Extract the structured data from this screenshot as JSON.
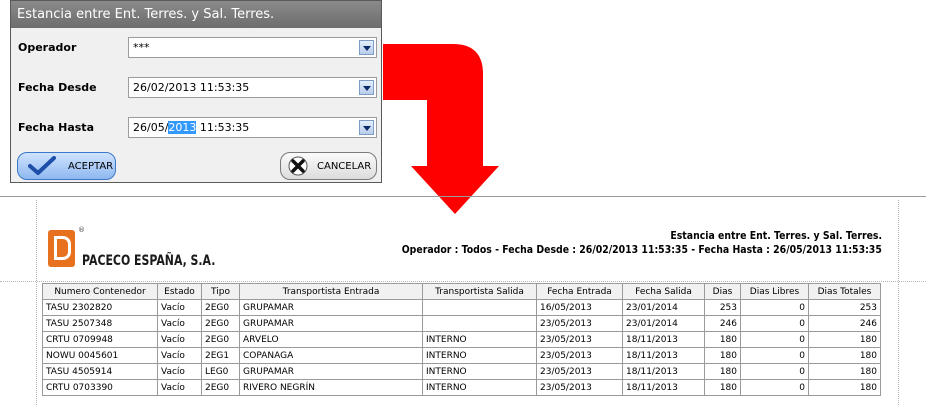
{
  "dialog": {
    "title": "Estancia entre Ent. Terres. y Sal. Terres.",
    "fields": [
      {
        "label": "Operador",
        "value": "***"
      },
      {
        "label": "Fecha Desde",
        "value": "26/02/2013 11:53:35"
      },
      {
        "label": "Fecha Hasta",
        "value_pre": "26/05/",
        "value_selected": "2013",
        "value_post": " 11:53:35"
      }
    ],
    "accept_label": "ACEPTAR",
    "cancel_label": "CANCELAR"
  },
  "colors": {
    "arrow": "#ff0000",
    "logo": "#e8711f"
  },
  "report": {
    "company": "PACECO ESPAÑA, S.A.",
    "logo_mark": "®",
    "title": "Estancia entre Ent. Terres. y Sal. Terres.",
    "subtitle": "Operador : Todos  -  Fecha Desde : 26/02/2013 11:53:35  -  Fecha Hasta : 26/05/2013 11:53:35",
    "columns": [
      "Numero Contenedor",
      "Estado",
      "Tipo",
      "Transportista Entrada",
      "Transportista Salida",
      "Fecha Entrada",
      "Fecha Salida",
      "Dias",
      "Dias Libres",
      "Dias Totales"
    ],
    "rows": [
      [
        "TASU 2302820",
        "Vacío",
        "2EG0",
        "GRUPAMAR",
        "",
        "16/05/2013",
        "23/01/2014",
        "253",
        "0",
        "253"
      ],
      [
        "TASU 2507348",
        "Vacío",
        "2EG0",
        "GRUPAMAR",
        "",
        "23/05/2013",
        "23/01/2014",
        "246",
        "0",
        "246"
      ],
      [
        "CRTU 0709948",
        "Vacío",
        "2EG0",
        "ARVELO",
        "INTERNO",
        "23/05/2013",
        "18/11/2013",
        "180",
        "0",
        "180"
      ],
      [
        "NOWU 0045601",
        "Vacío",
        "2EG1",
        "COPANAGA",
        "INTERNO",
        "23/05/2013",
        "18/11/2013",
        "180",
        "0",
        "180"
      ],
      [
        "TASU 4505914",
        "Vacío",
        "LEG0",
        "GRUPAMAR",
        "INTERNO",
        "23/05/2013",
        "18/11/2013",
        "180",
        "0",
        "180"
      ],
      [
        "CRTU 0703390",
        "Vacío",
        "2EG0",
        "RIVERO NEGRÍN",
        "INTERNO",
        "23/05/2013",
        "18/11/2013",
        "180",
        "0",
        "180"
      ]
    ]
  }
}
